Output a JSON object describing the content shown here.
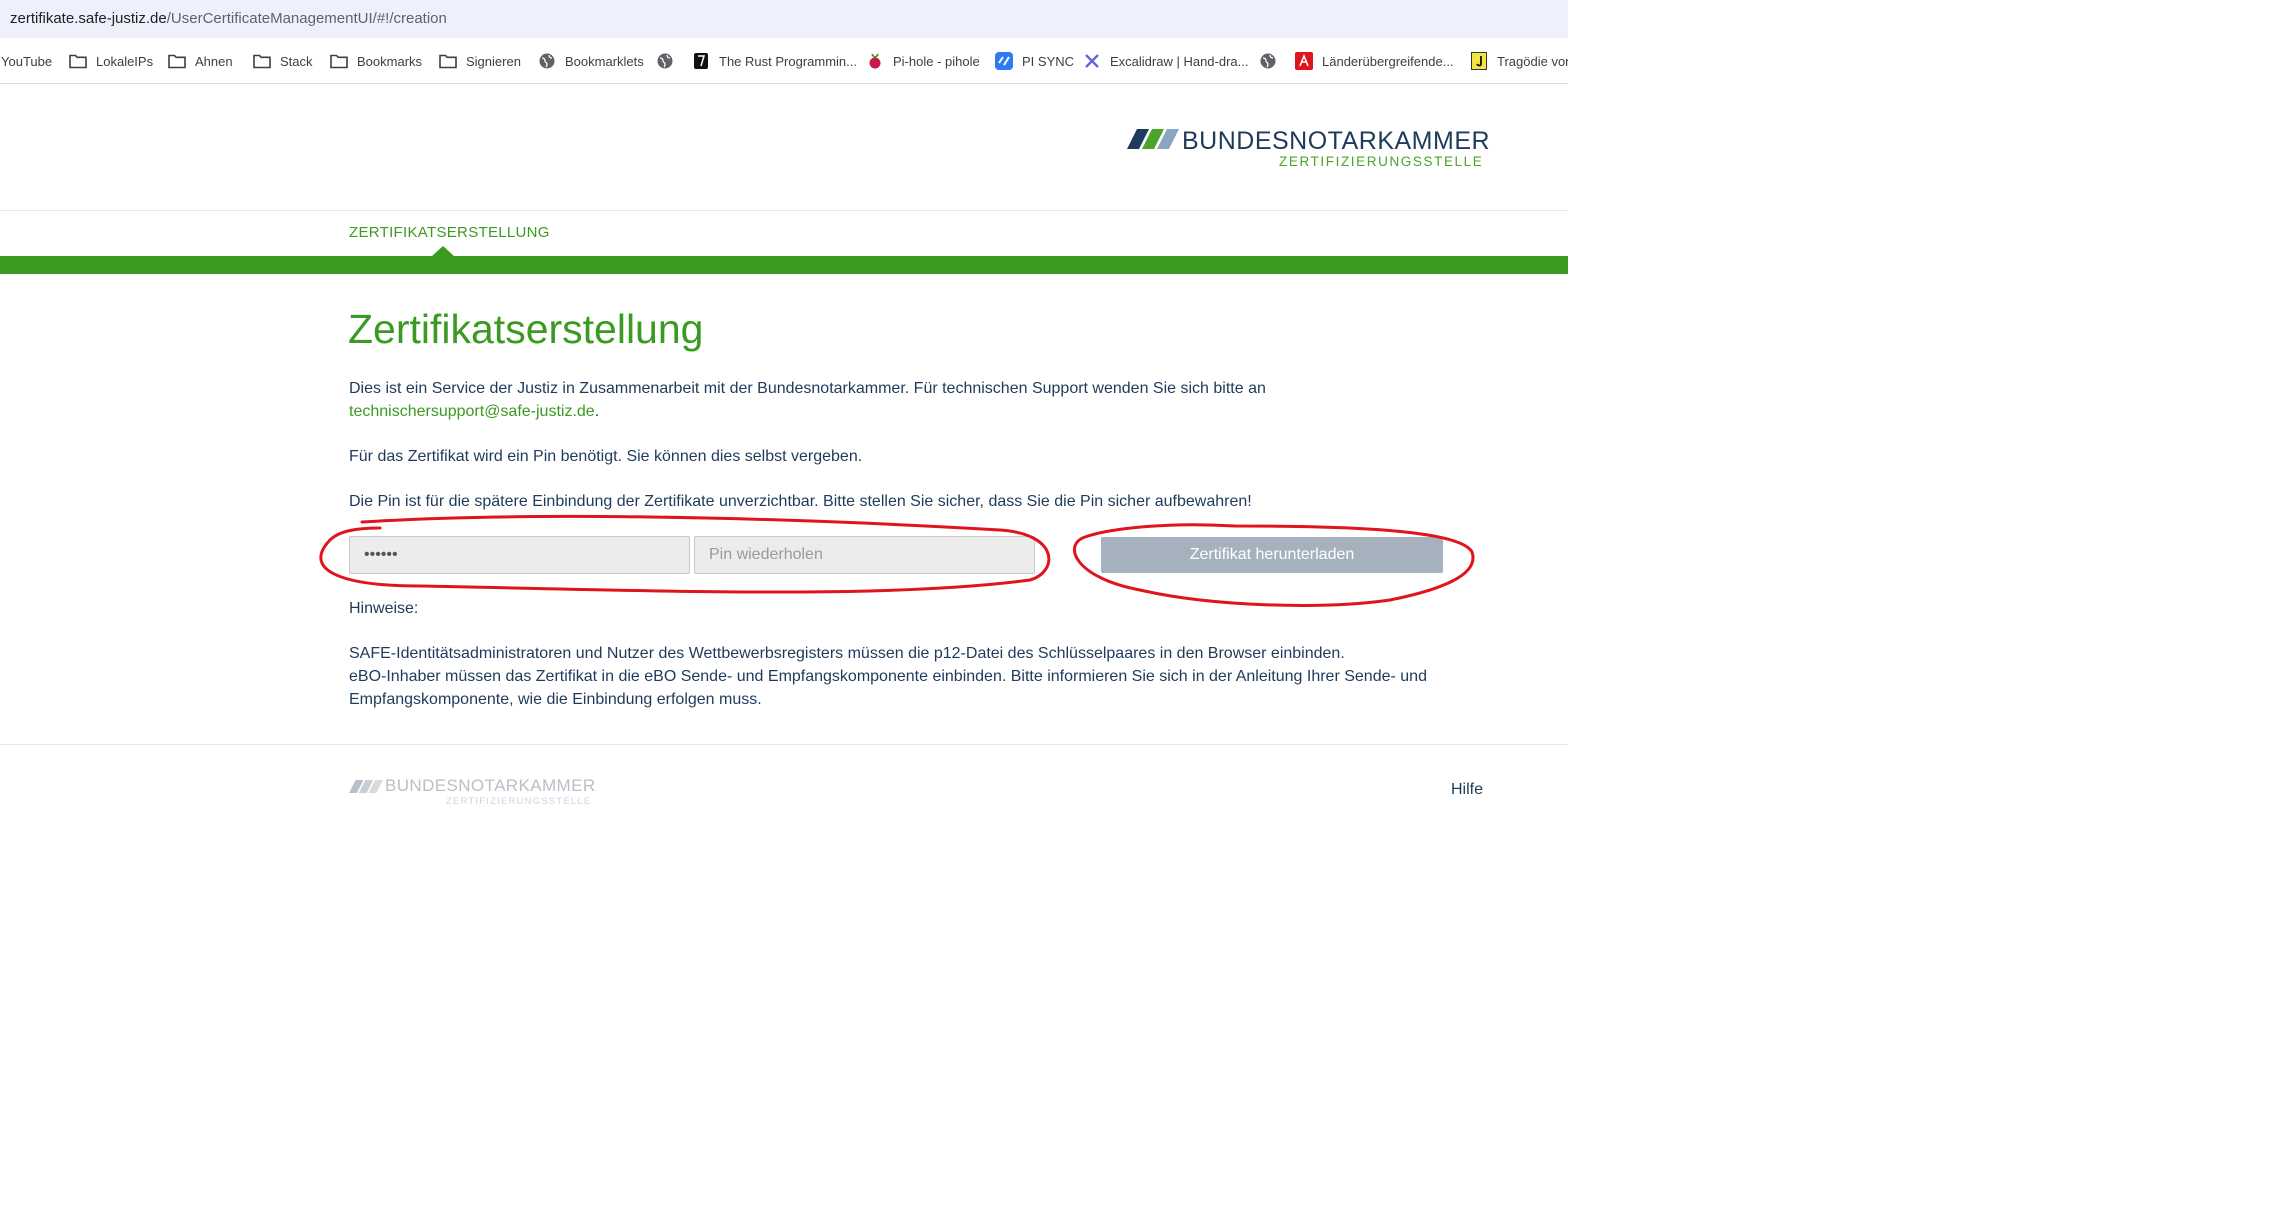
{
  "browser": {
    "url_host": "zertifikate.safe-justiz.de",
    "url_path": "/UserCertificateManagementUI/#!/creation",
    "bookmarks": [
      {
        "label": "YouTube",
        "icon": "none"
      },
      {
        "label": "LokaleIPs",
        "icon": "folder-icon"
      },
      {
        "label": "Ahnen",
        "icon": "folder-icon"
      },
      {
        "label": "Stack",
        "icon": "folder-icon"
      },
      {
        "label": "Bookmarks",
        "icon": "folder-icon"
      },
      {
        "label": "Signieren",
        "icon": "folder-icon"
      },
      {
        "label": "Bookmarklets",
        "icon": "globe-icon"
      },
      {
        "label": "",
        "icon": "globe-icon"
      },
      {
        "label": "The Rust Programmin...",
        "icon": "rust-book-icon"
      },
      {
        "label": "Pi-hole - pihole",
        "icon": "raspberry-icon"
      },
      {
        "label": "PI SYNC",
        "icon": "pi-sync-icon"
      },
      {
        "label": "Excalidraw | Hand-dra...",
        "icon": "excalidraw-icon"
      },
      {
        "label": "",
        "icon": "globe-icon"
      },
      {
        "label": "Länderübergreifende...",
        "icon": "red-app-icon"
      },
      {
        "label": "Tragödie von",
        "icon": "yellow-j-icon"
      }
    ]
  },
  "header": {
    "logo_name": "BUNDESNOTARKAMMER",
    "logo_sub": "ZERTIFIZIERUNGSSTELLE",
    "nav_tab": "ZERTIFIKATSERSTELLUNG"
  },
  "main": {
    "title": "Zertifikatserstellung",
    "intro_line1": "Dies ist ein Service der Justiz in Zusammenarbeit mit der Bundesnotarkammer. Für technischen Support wenden Sie sich bitte an",
    "support_email": "technischersupport@safe-justiz.de",
    "intro_period": ".",
    "pin_info": "Für das Zertifikat wird ein Pin benötigt. Sie können dies selbst vergeben.",
    "pin_warning": "Die Pin ist für die spätere Einbindung der Zertifikate unverzichtbar. Bitte stellen Sie sicher, dass Sie die Pin sicher aufbewahren!",
    "pin_value": "••••••",
    "pin_repeat_placeholder": "Pin wiederholen",
    "download_button": "Zertifikat herunterladen",
    "notes_heading": "Hinweise:",
    "note1": "SAFE-Identitätsadministratoren und Nutzer des Wettbewerbsregisters müssen die p12-Datei des Schlüsselpaares in den Browser einbinden.",
    "note2_line1": "eBO-Inhaber müssen das Zertifikat in die eBO Sende- und Empfangskomponente einbinden. Bitte informieren Sie sich in der Anleitung Ihrer Sende- und",
    "note2_line2": "Empfangskomponente, wie die Einbindung erfolgen muss."
  },
  "footer": {
    "logo_name": "BUNDESNOTARKAMMER",
    "logo_sub": "ZERTIFIZIERUNGSSTELLE",
    "help_link": "Hilfe"
  },
  "colors": {
    "brand_green": "#3b9a21",
    "brand_navy": "#1f3a5a",
    "annotation_red": "#e0141c",
    "button_disabled": "#a5b1bd"
  }
}
